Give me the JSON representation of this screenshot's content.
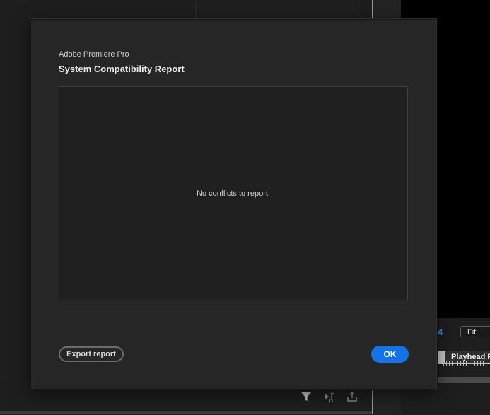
{
  "dialog": {
    "app_name": "Adobe Premiere Pro",
    "title": "System Compatibility Report",
    "message": "No conflicts to report.",
    "export_label": "Export report",
    "ok_label": "OK"
  },
  "background": {
    "timecode_digit": "4",
    "zoom_value": "Fit",
    "playhead_label": "Playhead P",
    "toolbar_icons": [
      "filter-icon",
      "play-to-marker-icon",
      "export-frame-icon"
    ]
  },
  "colors": {
    "accent": "#1473e6",
    "timecode": "#3b8ef0",
    "dialog_bg": "#262626",
    "app_bg": "#1d1d1d"
  }
}
